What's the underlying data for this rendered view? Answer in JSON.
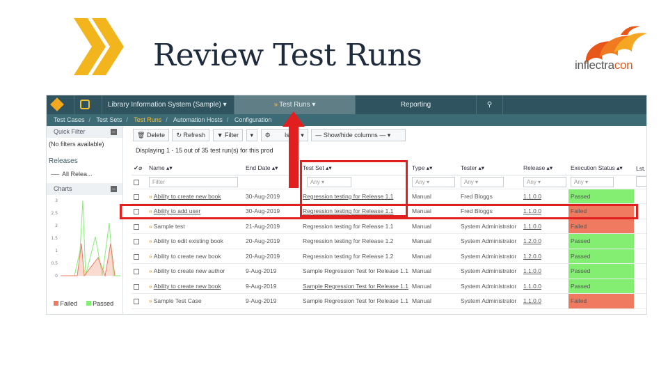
{
  "slide": {
    "title": "Review Test Runs",
    "logo_text_a": "inflectra",
    "logo_text_b": "con"
  },
  "colors": {
    "accent": "#f2a91f",
    "nav": "#2f5460",
    "highlight": "#e21f1f",
    "passed": "#83ee72",
    "failed": "#ef7a60"
  },
  "topnav": {
    "product": "Library Information System (Sample)",
    "test_runs": "Test Runs",
    "reporting": "Reporting"
  },
  "subnav": [
    "Test Cases",
    "Test Sets",
    "Test Runs",
    "Automation Hosts",
    "Configuration"
  ],
  "sidebar": {
    "quick_filter": "Quick Filter",
    "no_filters": "(No filters available)",
    "releases": "Releases",
    "all_releases": "All Relea...",
    "charts": "Charts",
    "yticks": [
      "3",
      "2.5",
      "2",
      "1.5",
      "1",
      "0.5",
      "0"
    ],
    "legend": [
      "Failed",
      "Passed"
    ]
  },
  "toolbar": {
    "delete": "Delete",
    "refresh": "Refresh",
    "filter": "Filter",
    "tools": "ls",
    "show_hide": "Show/hide columns"
  },
  "displaying": "Displaying 1 - 15 out of 35 test run(s) for this prod",
  "columns": {
    "name": "Name",
    "end_date": "End Date",
    "test_set": "Test Set",
    "type": "Type",
    "tester": "Tester",
    "release": "Release",
    "exec_status": "Execution Status",
    "last": "Lst."
  },
  "filters": {
    "name": "Filter",
    "any": "Any"
  },
  "rows": [
    {
      "name": "Ability to create new book",
      "date": "30-Aug-2019",
      "test_set": "Regression testing for Release 1.1",
      "type": "Manual",
      "tester": "Fred Bloggs",
      "release": "1.1.0.0",
      "status": "Passed"
    },
    {
      "name": "Ability to add user",
      "date": "30-Aug-2019",
      "test_set": "Regression testing for Release 1.1",
      "type": "Manual",
      "tester": "Fred Bloggs",
      "release": "1.1.0.0",
      "status": "Failed"
    },
    {
      "name": "Sample test",
      "date": "21-Aug-2019",
      "test_set": "Regression testing for Release 1.1",
      "type": "Manual",
      "tester": "System Administrator",
      "release": "1.1.0.0",
      "status": "Failed"
    },
    {
      "name": "Ability to edit existing book",
      "date": "20-Aug-2019",
      "test_set": "Regression testing for Release 1.2",
      "type": "Manual",
      "tester": "System Administrator",
      "release": "1.2.0.0",
      "status": "Passed"
    },
    {
      "name": "Ability to create new book",
      "date": "20-Aug-2019",
      "test_set": "Regression testing for Release 1.2",
      "type": "Manual",
      "tester": "System Administrator",
      "release": "1.2.0.0",
      "status": "Passed"
    },
    {
      "name": "Ability to create new author",
      "date": "9-Aug-2019",
      "test_set": "Sample Regression Test for Release 1.1",
      "type": "Manual",
      "tester": "System Administrator",
      "release": "1.1.0.0",
      "status": "Passed"
    },
    {
      "name": "Ability to create new book",
      "date": "9-Aug-2019",
      "test_set": "Sample Regression Test for Release 1.1",
      "type": "Manual",
      "tester": "System Administrator",
      "release": "1.1.0.0",
      "status": "Passed"
    },
    {
      "name": "Sample Test Case",
      "date": "9-Aug-2019",
      "test_set": "Sample Regression Test for Release 1.1",
      "type": "Manual",
      "tester": "System Administrator",
      "release": "1.1.0.0",
      "status": "Failed"
    }
  ]
}
